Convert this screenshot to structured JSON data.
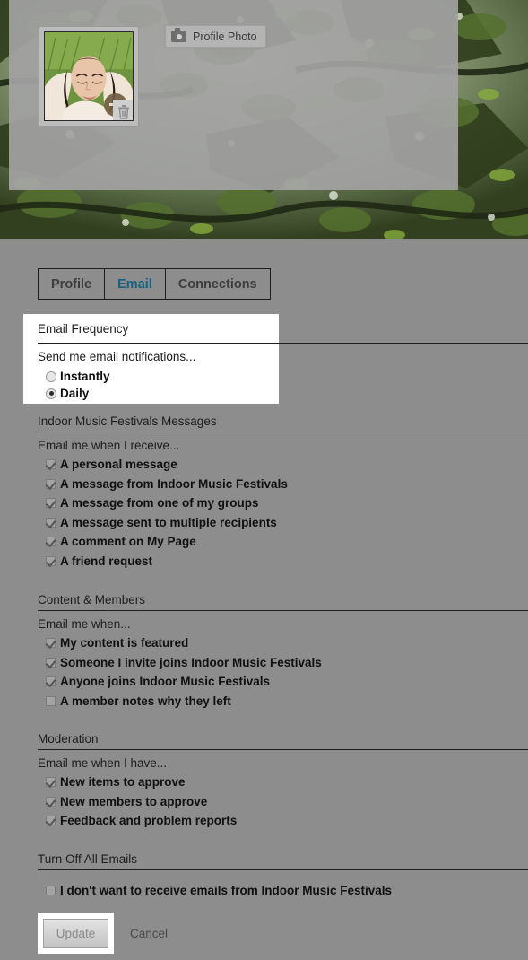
{
  "profile_panel": {
    "photo_alt": "profile-thumbnail",
    "edit_photo_icon": "edit-photo-icon",
    "delete_photo_icon": "trash-icon",
    "profile_photo_button": {
      "label": "Profile Photo",
      "icon": "camera-icon"
    }
  },
  "tabs": [
    {
      "label": "Profile",
      "active": false
    },
    {
      "label": "Email",
      "active": true
    },
    {
      "label": "Connections",
      "active": false
    }
  ],
  "email_frequency": {
    "title": "Email Frequency",
    "intro": "Send me email notifications...",
    "options": [
      {
        "label": "Instantly",
        "selected": false
      },
      {
        "label": "Daily",
        "selected": true
      }
    ]
  },
  "sections": [
    {
      "title": "Indoor Music Festivals Messages",
      "intro": "Email me when I receive...",
      "items": [
        {
          "label": "A personal message",
          "checked": true
        },
        {
          "label": "A message from Indoor Music Festivals",
          "checked": true
        },
        {
          "label": "A message from one of my groups",
          "checked": true
        },
        {
          "label": "A message sent to multiple recipients",
          "checked": true
        },
        {
          "label": "A comment on My Page",
          "checked": true
        },
        {
          "label": "A friend request",
          "checked": true
        }
      ]
    },
    {
      "title": "Content & Members",
      "intro": "Email me when...",
      "items": [
        {
          "label": "My content is featured",
          "checked": true
        },
        {
          "label": "Someone I invite joins Indoor Music Festivals",
          "checked": true
        },
        {
          "label": "Anyone joins Indoor Music Festivals",
          "checked": true
        },
        {
          "label": "A member notes why they left",
          "checked": false
        }
      ]
    },
    {
      "title": "Moderation",
      "intro": "Email me when I have...",
      "items": [
        {
          "label": "New items to approve",
          "checked": true
        },
        {
          "label": "New members to approve",
          "checked": true
        },
        {
          "label": "Feedback and problem reports",
          "checked": true
        }
      ]
    },
    {
      "title": "Turn Off All Emails",
      "intro": "",
      "items": [
        {
          "label": "I don't want to receive emails from Indoor Music Festivals",
          "checked": false
        }
      ]
    }
  ],
  "actions": {
    "update_label": "Update",
    "cancel_label": "Cancel"
  },
  "colors": {
    "accent": "#15627d",
    "overlay": "#8d8d8d",
    "panel": "#a2a2a2",
    "popup": "#ffffff"
  }
}
